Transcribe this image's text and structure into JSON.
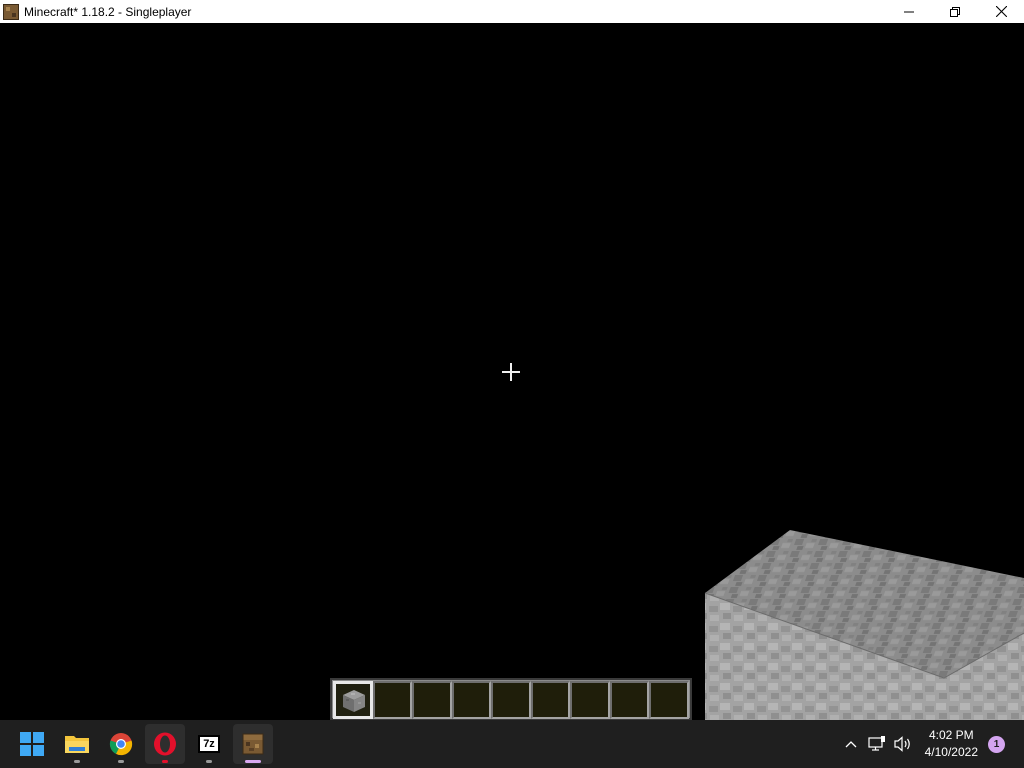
{
  "window": {
    "title": "Minecraft* 1.18.2 - Singleplayer",
    "icon": "minecraft-grass-block-icon",
    "controls": [
      "minimize-icon",
      "restore-icon",
      "close-icon"
    ]
  },
  "game": {
    "crosshair": "crosshair-icon",
    "held_item": "stone-block",
    "hotbar": {
      "slot_count": 9,
      "selected_slot": 1,
      "slots": [
        {
          "item": "stone-block"
        },
        {
          "item": ""
        },
        {
          "item": ""
        },
        {
          "item": ""
        },
        {
          "item": ""
        },
        {
          "item": ""
        },
        {
          "item": ""
        },
        {
          "item": ""
        },
        {
          "item": ""
        }
      ]
    }
  },
  "taskbar": {
    "apps": [
      {
        "name": "Start",
        "icon": "windows-start-icon"
      },
      {
        "name": "File Explorer",
        "icon": "folder-icon"
      },
      {
        "name": "Google Chrome",
        "icon": "chrome-icon"
      },
      {
        "name": "Opera",
        "icon": "opera-icon"
      },
      {
        "name": "7-Zip",
        "icon": "7zip-icon",
        "label": "7z"
      },
      {
        "name": "Minecraft",
        "icon": "minecraft-icon"
      }
    ],
    "tray": {
      "icons": [
        "chevron-up-icon",
        "network-icon",
        "volume-icon"
      ],
      "time": "4:02 PM",
      "date": "4/10/2022",
      "notification_count": "1"
    }
  },
  "colors": {
    "taskbar_bg": "#1f1f1f",
    "titlebar_bg": "#ffffff",
    "viewport_bg": "#000000",
    "stone": "#8a8a8a",
    "accent": "#d9a8f0"
  }
}
